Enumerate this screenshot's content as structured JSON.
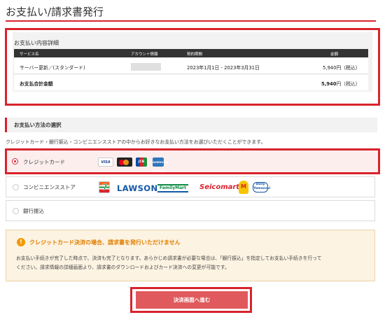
{
  "page": {
    "title": "お支払い/請求書発行"
  },
  "details": {
    "heading": "お支払い内容詳細",
    "columns": [
      "サービス名",
      "アカウント情報",
      "契約期間",
      "金額"
    ],
    "row": {
      "service": "サーバー更新／(スタンダード)",
      "period": "2023年1月1日 - 2023年3月31日",
      "amount": "5,940円（税込）"
    },
    "total": {
      "label": "お支払合計金額",
      "amount_number": "5,940",
      "amount_suffix": "円（税込）"
    }
  },
  "method": {
    "section_title": "お支払い方法の選択",
    "description": "クレジットカード・銀行振込・コンビニエンスストアの中からお好きなお支払い方法をお選びいただくことができます。",
    "options": [
      {
        "label": "クレジットカード",
        "selected": true,
        "brands": [
          "VISA",
          "Mastercard",
          "JCB",
          "AMEX"
        ]
      },
      {
        "label": "コンビニエンスストア",
        "selected": false,
        "brands": [
          "7-Eleven",
          "LAWSON",
          "FamilyMart",
          "Seicomart",
          "MINISTOP",
          "Daily Yamazaki"
        ]
      },
      {
        "label": "銀行振込",
        "selected": false
      }
    ]
  },
  "logos": {
    "visa": "VISA",
    "jcb": "JCB",
    "amex": "AMERICAN EXPRESS",
    "seven": "7",
    "lawson": "LAWSON",
    "familymart": "FamilyMart",
    "seicomart": "Seicomart",
    "ministop": "M",
    "daily": "Daily Yamazaki"
  },
  "notice": {
    "title": "クレジットカード決済の場合、請求書を発行いただけません",
    "body_line1": "お支払い手続きが完了した時点で、決済も完了となります。あらかじめ請求書が必要な場合は、「銀行振込」を指定してお支払い手続きを行って",
    "body_line2": "ください。請求情報の詳細画面より、請求書のダウンロードおよびカード決済への変更が可能です。"
  },
  "actions": {
    "proceed_label": "決済画面へ進む"
  },
  "colors": {
    "accent": "#d9232d",
    "button": "#e05a5d",
    "notice_bg": "#fdf3e2",
    "notice_title": "#e07f00"
  },
  "icons": {
    "warning": "warning-icon"
  }
}
